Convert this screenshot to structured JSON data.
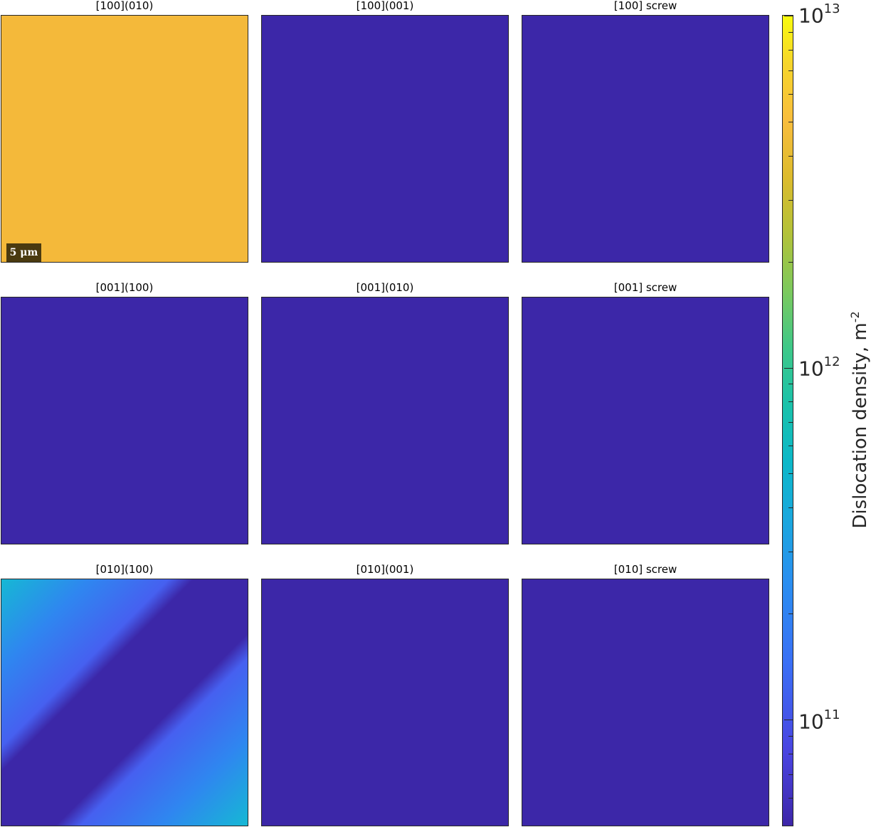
{
  "chart_data": {
    "type": "heatmap",
    "colorbar": {
      "label": "Dislocation density, m",
      "label_sup": "-2",
      "scale": "log",
      "range": [
        50000000000.0,
        10000000000000.0
      ],
      "ticks": [
        {
          "base": "10",
          "exp": "11",
          "value": 100000000000.0
        },
        {
          "base": "10",
          "exp": "12",
          "value": 1000000000000.0
        },
        {
          "base": "10",
          "exp": "13",
          "value": 10000000000000.0
        }
      ]
    },
    "panels": [
      {
        "title": "[100](010)",
        "value": 5500000000000.0,
        "pattern": "uniform",
        "scalebar": "5 μm"
      },
      {
        "title": "[100](001)",
        "value": 50000000000.0,
        "pattern": "uniform"
      },
      {
        "title": "[100] screw",
        "value": 50000000000.0,
        "pattern": "uniform"
      },
      {
        "title": "[001](100)",
        "value": 50000000000.0,
        "pattern": "uniform"
      },
      {
        "title": "[001](010)",
        "value": 50000000000.0,
        "pattern": "uniform"
      },
      {
        "title": "[001] screw",
        "value": 50000000000.0,
        "pattern": "uniform"
      },
      {
        "title": "[010](100)",
        "value_min": 50000000000.0,
        "value_max": 500000000000.0,
        "pattern": "diagonal-band"
      },
      {
        "title": "[010](001)",
        "value": 50000000000.0,
        "pattern": "uniform"
      },
      {
        "title": "[010] screw",
        "value": 50000000000.0,
        "pattern": "uniform"
      }
    ]
  }
}
